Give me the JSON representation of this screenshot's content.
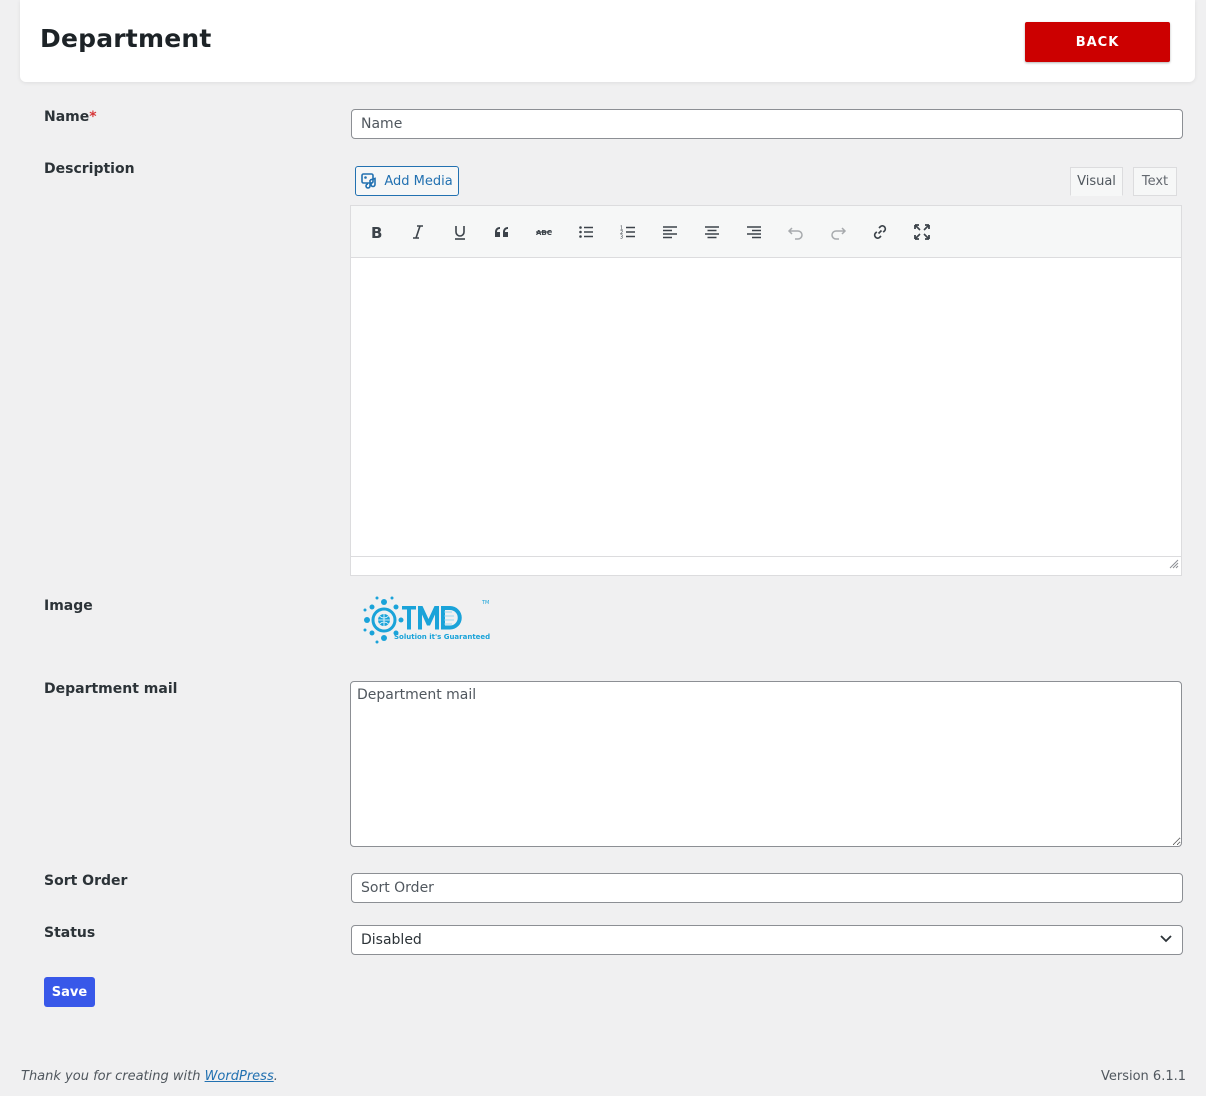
{
  "header": {
    "title": "Department",
    "back_label": "BACK",
    "accent_color": "#cc0000"
  },
  "form": {
    "name": {
      "label": "Name",
      "required_mark": "*",
      "placeholder": "Name",
      "value": ""
    },
    "description": {
      "label": "Description",
      "add_media_label": "Add Media",
      "tabs": [
        "Visual",
        "Text"
      ],
      "active_tab": "Visual",
      "toolbar_icons": [
        "bold-icon",
        "italic-icon",
        "underline-icon",
        "blockquote-icon",
        "strikethrough-icon",
        "bullet-list-icon",
        "numbered-list-icon",
        "align-left-icon",
        "align-center-icon",
        "align-right-icon",
        "undo-icon",
        "redo-icon",
        "link-icon",
        "fullscreen-icon"
      ]
    },
    "image": {
      "label": "Image"
    },
    "department_mail": {
      "label": "Department mail",
      "placeholder": "Department mail"
    },
    "sort_order": {
      "label": "Sort Order",
      "placeholder": "Sort Order"
    },
    "status": {
      "label": "Status",
      "value": "Disabled"
    },
    "save_label": "Save",
    "save_color": "#3858e9"
  },
  "footer": {
    "thanks_prefix": "Thank you for creating with ",
    "thanks_link": "WordPress",
    "thanks_suffix": ".",
    "version": "Version 6.1.1"
  }
}
